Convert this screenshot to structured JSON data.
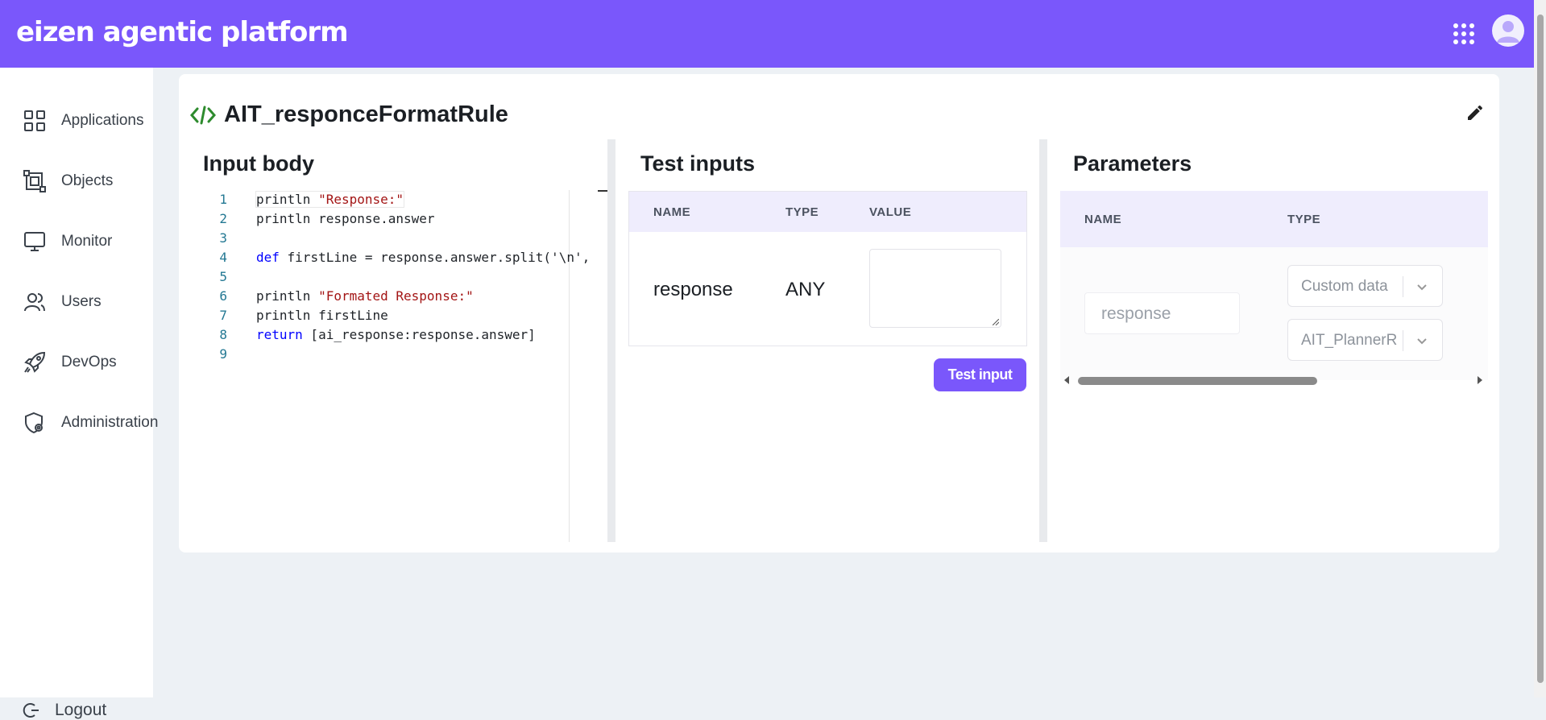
{
  "header": {
    "brand": "eizen agentic platform"
  },
  "sidebar": {
    "items": [
      {
        "label": "Applications",
        "icon": "grid-icon"
      },
      {
        "label": "Objects",
        "icon": "objects-icon"
      },
      {
        "label": "Monitor",
        "icon": "monitor-icon"
      },
      {
        "label": "Users",
        "icon": "users-icon"
      },
      {
        "label": "DevOps",
        "icon": "rocket-icon"
      },
      {
        "label": "Administration",
        "icon": "shield-gear-icon"
      }
    ],
    "logout": "Logout"
  },
  "page": {
    "title": "AIT_responceFormatRule"
  },
  "input_body": {
    "title": "Input body",
    "lines": [
      {
        "n": "1",
        "tokens": [
          {
            "t": "println ",
            "c": "plain"
          },
          {
            "t": "\"Response:\"",
            "c": "str"
          }
        ]
      },
      {
        "n": "2",
        "tokens": [
          {
            "t": "println response.answer",
            "c": "plain"
          }
        ]
      },
      {
        "n": "3",
        "tokens": []
      },
      {
        "n": "4",
        "tokens": [
          {
            "t": "def",
            "c": "kw"
          },
          {
            "t": " firstLine = response.answer.split('\\n',",
            "c": "plain"
          }
        ]
      },
      {
        "n": "5",
        "tokens": []
      },
      {
        "n": "6",
        "tokens": [
          {
            "t": "println ",
            "c": "plain"
          },
          {
            "t": "\"Formated Response:\"",
            "c": "str"
          }
        ]
      },
      {
        "n": "7",
        "tokens": [
          {
            "t": "println firstLine",
            "c": "plain"
          }
        ]
      },
      {
        "n": "8",
        "tokens": [
          {
            "t": "return",
            "c": "kw"
          },
          {
            "t": " [ai_response:response.answer]",
            "c": "plain"
          }
        ]
      },
      {
        "n": "9",
        "tokens": []
      }
    ]
  },
  "test_inputs": {
    "title": "Test inputs",
    "headers": {
      "name": "NAME",
      "type": "TYPE",
      "value": "VALUE"
    },
    "row": {
      "name": "response",
      "type": "ANY",
      "value": ""
    },
    "button": "Test input"
  },
  "parameters": {
    "title": "Parameters",
    "headers": {
      "name": "NAME",
      "type": "TYPE"
    },
    "row": {
      "name": "response",
      "type_primary": "Custom data",
      "type_secondary": "AIT_PlannerR"
    }
  }
}
